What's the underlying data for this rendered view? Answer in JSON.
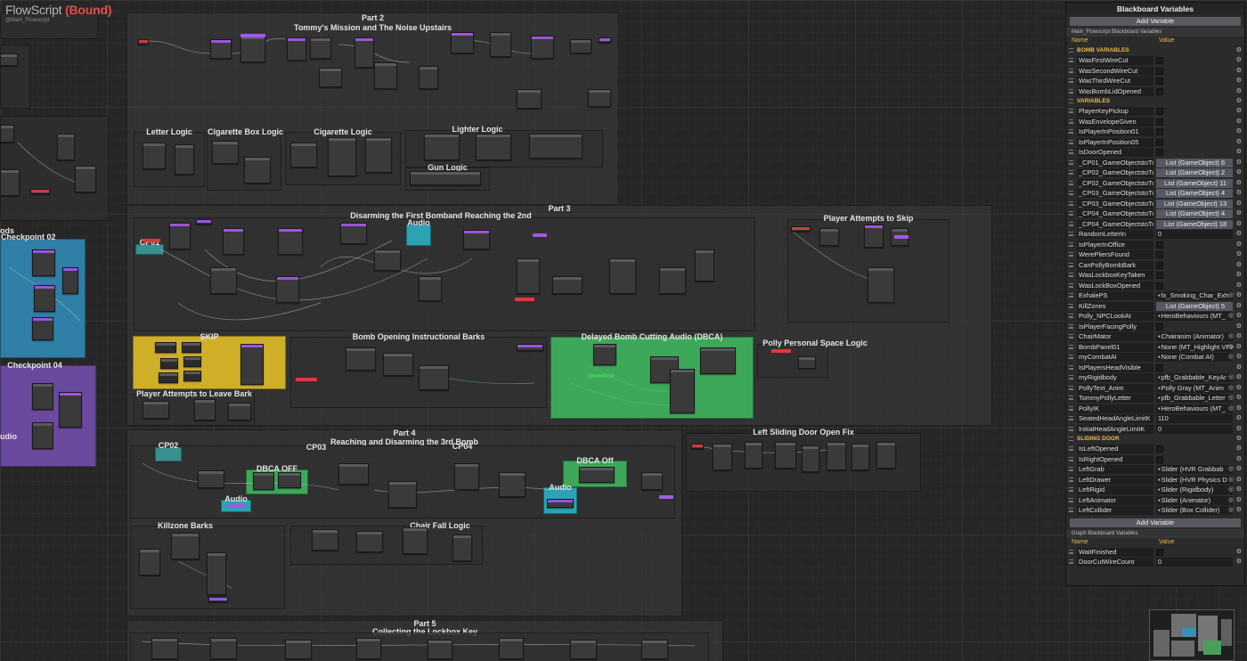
{
  "header": {
    "title": "FlowScript",
    "bound": "(Bound)",
    "subtitle": "@Main_Flowscript"
  },
  "groups": {
    "part2": "Part 2",
    "part2_sub": "Tommy's Mission and The Noise Upstairs",
    "letter": "Letter Logic",
    "cigbox": "Cigarette Box Logic",
    "cig": "Cigarette Logic",
    "lighter": "Lighter Logic",
    "gun": "Gun Logic",
    "part3": "Part 3",
    "part3_sub": "Disarming the First Bomband Reaching the 2nd",
    "audio": "Audio",
    "cp01": "CP01",
    "attempts_skip": "Player Attempts to Skip",
    "skip": "SKIP",
    "leave_bark": "Player Attempts to Leave Bark",
    "bomb_barks": "Bomb Opening Instructional Barks",
    "dbca": "Delayed Bomb Cutting Audio (DBCA)",
    "polly_space": "Polly Personal Space Logic",
    "part4": "Part 4",
    "part4_sub": "Reaching and Disarming the 3rd Bomb",
    "cp02": "CP02",
    "cp03": "CP03",
    "cp04": "CP04",
    "dbca_off": "DBCA OFF",
    "dbca_off2": "DBCA Off",
    "left_door": "Left Sliding Door Open Fix",
    "killzone": "Killzone Barks",
    "chair_fall": "Chair Fall Logic",
    "part5": "Part 5",
    "part5_sub": "Collecting the Lockbox Key",
    "checkpoint02": "Checkpoint 02",
    "checkpoint04": "Checkpoint 04",
    "ods": "ods",
    "udio": "udio"
  },
  "blackboard": {
    "title": "Blackboard Variables",
    "add_label": "Add Variable",
    "section1": "Main_Flowscript Blackboard Variables",
    "col_name": "Name",
    "col_value": "Value",
    "cat_bomb": "BOMB VARIABLES",
    "bomb_vars": [
      "WasFirstWireCut",
      "WasSecondWireCut",
      "WasThirdWireCut",
      "WasBombLidOpened"
    ],
    "cat_vars": "VARIABLES",
    "vars": [
      {
        "n": "PlayerKeyPickup",
        "t": "chk"
      },
      {
        "n": "WasEnvelopeGiven",
        "t": "chk"
      },
      {
        "n": "IsPlayerInPosition01",
        "t": "chk"
      },
      {
        "n": "IsPlayerInPosition05",
        "t": "chk"
      },
      {
        "n": "IsDoorOpened",
        "t": "chk"
      },
      {
        "n": "_CP01_GameObjectstoTur",
        "t": "list",
        "v": "List (GameObject) 6"
      },
      {
        "n": "_CP02_GameObjectstoTur",
        "t": "list",
        "v": "List (GameObject) 2"
      },
      {
        "n": "_CP02_GameObjectstoTur",
        "t": "list",
        "v": "List (GameObject) 11"
      },
      {
        "n": "_CP03_GameObjectstoTur",
        "t": "list",
        "v": "List (GameObject) 4"
      },
      {
        "n": "_CP03_GameObjectstoTur",
        "t": "list",
        "v": "List (GameObject) 13"
      },
      {
        "n": "_CP04_GameObjectstoTur",
        "t": "list",
        "v": "List (GameObject) 4"
      },
      {
        "n": "_CP04_GameObjectstoTur",
        "t": "list",
        "v": "List (GameObject) 18"
      },
      {
        "n": "RandomLetterIn",
        "t": "box",
        "v": "0"
      },
      {
        "n": "IsPlayerInOffice",
        "t": "chk"
      },
      {
        "n": "WerePliersFound",
        "t": "chk"
      },
      {
        "n": "CanPollyBombBark",
        "t": "chk"
      },
      {
        "n": "WasLockboxKeyTaken",
        "t": "chk"
      },
      {
        "n": "WasLockBoxOpened",
        "t": "chk"
      },
      {
        "n": "ExhalePS",
        "t": "obj",
        "v": "fx_Smoking_Char_Exh"
      },
      {
        "n": "KillZones",
        "t": "list",
        "v": "List (GameObject) 5"
      },
      {
        "n": "Polly_NPCLookAt",
        "t": "obj",
        "v": "HeroBehaviours (MT_"
      },
      {
        "n": "IsPlayerFacingPolly",
        "t": "chk"
      },
      {
        "n": "ChairMator",
        "t": "obj",
        "v": "Chairanim (Animator)"
      },
      {
        "n": "BombPanel01",
        "t": "obj",
        "v": "None (MT_Highlight VFX"
      },
      {
        "n": "myCombatAI",
        "t": "obj",
        "v": "None (Combat AI)"
      },
      {
        "n": "IsPlayersHeadVisible",
        "t": "chk"
      },
      {
        "n": "myRigidbody",
        "t": "obj",
        "v": "pfb_Grabbable_KeyAr"
      },
      {
        "n": "PollyText_Anim",
        "t": "obj",
        "v": "Polly Gray (MT_Anim"
      },
      {
        "n": "TommyPollyLetter",
        "t": "obj",
        "v": "pfb_Grabbable_Letter"
      },
      {
        "n": "PollyIK",
        "t": "obj",
        "v": "HeroBehaviours (MT_"
      },
      {
        "n": "SeatedHeadAngleLimitK",
        "t": "box",
        "v": "110"
      },
      {
        "n": "InitialHeadAngleLimitK",
        "t": "box",
        "v": "0"
      }
    ],
    "cat_door": "SLIDING DOOR",
    "door_vars": [
      {
        "n": "IsLeftOpened",
        "t": "chk"
      },
      {
        "n": "IsRightOpened",
        "t": "chk"
      },
      {
        "n": "LeftGrab",
        "t": "obj",
        "v": "Slider (HVR Grabbab"
      },
      {
        "n": "LeftDrawer",
        "t": "obj",
        "v": "Slider (HVR Physics D"
      },
      {
        "n": "LeftRigid",
        "t": "obj",
        "v": "Slider (Rigidbody)"
      },
      {
        "n": "LeftAnimator",
        "t": "obj",
        "v": "Slider (Animator)"
      },
      {
        "n": "LeftCollider",
        "t": "obj",
        "v": "Slider (Box Collider)"
      }
    ],
    "section2": "Graph Blackboard Variables",
    "graph_vars": [
      {
        "n": "WaitFinished",
        "t": "chk"
      },
      {
        "n": "DoorCutWireCount",
        "t": "box",
        "v": "0"
      }
    ]
  }
}
